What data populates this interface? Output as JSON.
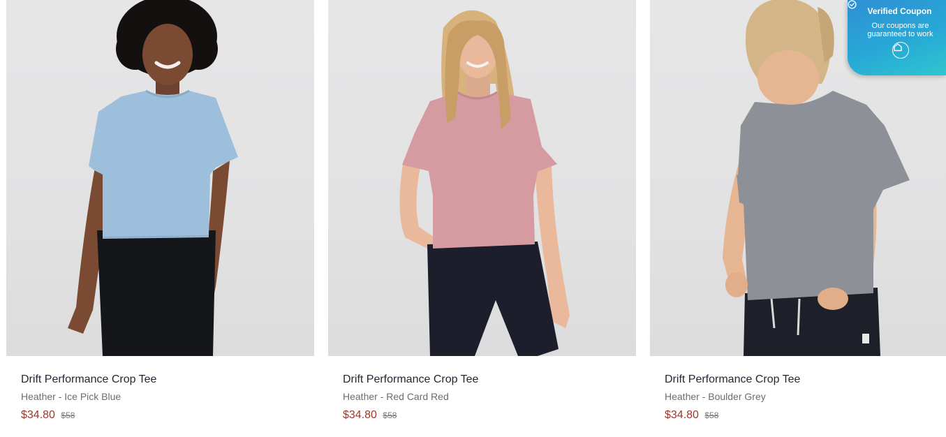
{
  "products": [
    {
      "name": "Drift Performance Crop Tee",
      "variant": "Heather - Ice Pick Blue",
      "sale_price": "$34.80",
      "original_price": "$58",
      "shirt_color": "#9dbfdc",
      "skin_color": "#7a4a32",
      "hair_color": "#141010",
      "pants_color": "#15161a"
    },
    {
      "name": "Drift Performance Crop Tee",
      "variant": "Heather - Red Card Red",
      "sale_price": "$34.80",
      "original_price": "$58",
      "shirt_color": "#d69aa1",
      "skin_color": "#eab89a",
      "hair_color": "#d7b27c",
      "pants_color": "#1c1f2b"
    },
    {
      "name": "Drift Performance Crop Tee",
      "variant": "Heather - Boulder Grey",
      "sale_price": "$34.80",
      "original_price": "$58",
      "shirt_color": "#8d9096",
      "skin_color": "#e6b592",
      "hair_color": "#d3b587",
      "pants_color": "#1e2029"
    }
  ],
  "coupon": {
    "title": "Verified Coupon",
    "subtitle_line1": "Our coupons are",
    "subtitle_line2": "guaranteed to work",
    "icon": "home-icon"
  },
  "colors": {
    "price_sale": "#a0362b",
    "name_text": "#1f2733",
    "variant_text": "#6d6d6d",
    "badge_start": "#2f8fd3",
    "badge_end": "#2fc6cf"
  }
}
